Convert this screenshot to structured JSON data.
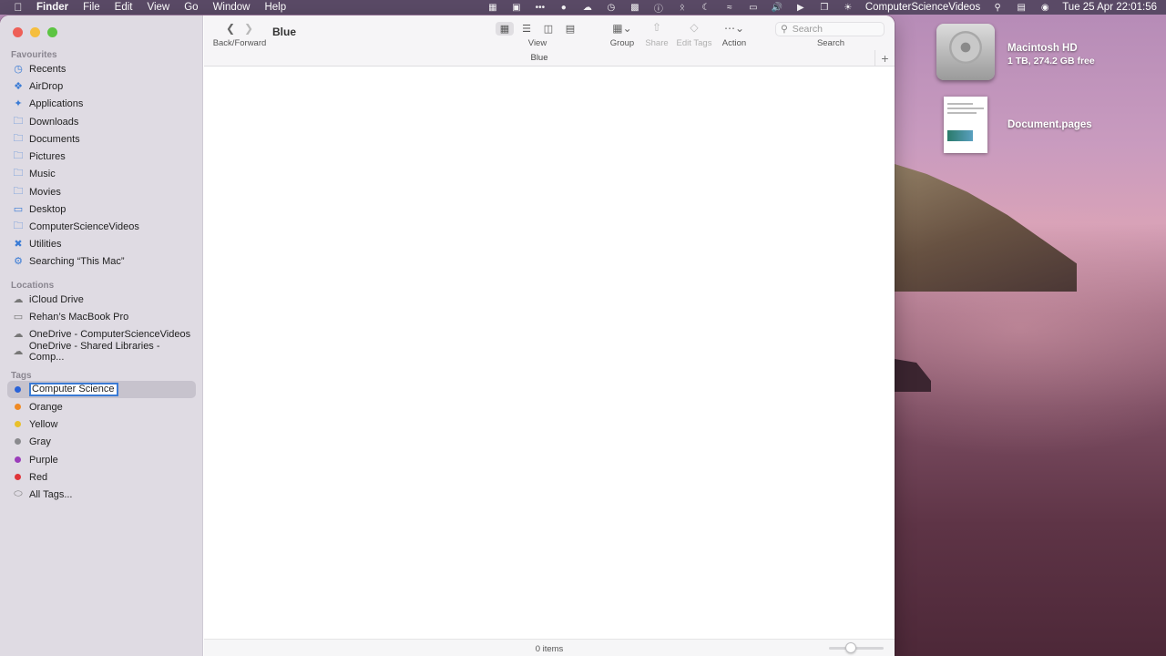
{
  "menubar": {
    "app": "Finder",
    "menus": [
      "File",
      "Edit",
      "View",
      "Go",
      "Window",
      "Help"
    ],
    "user": "ComputerScienceVideos",
    "datetime": "Tue 25 Apr  22:01:56"
  },
  "desktop": {
    "drive_name": "Macintosh HD",
    "drive_info": "1 TB, 274.2 GB free",
    "doc_name": "Document.pages"
  },
  "toolbar": {
    "back_forward_label": "Back/Forward",
    "window_title": "Blue",
    "view_label": "View",
    "group_label": "Group",
    "share_label": "Share",
    "edit_tags_label": "Edit Tags",
    "action_label": "Action",
    "search_label": "Search",
    "search_placeholder": "Search"
  },
  "path_bar": {
    "title": "Blue"
  },
  "sidebar": {
    "favourites_title": "Favourites",
    "favourites": [
      {
        "label": "Recents",
        "icon": "clock-icon"
      },
      {
        "label": "AirDrop",
        "icon": "airdrop-icon"
      },
      {
        "label": "Applications",
        "icon": "applications-icon"
      },
      {
        "label": "Downloads",
        "icon": "folder-icon"
      },
      {
        "label": "Documents",
        "icon": "folder-icon"
      },
      {
        "label": "Pictures",
        "icon": "folder-icon"
      },
      {
        "label": "Music",
        "icon": "folder-icon"
      },
      {
        "label": "Movies",
        "icon": "folder-icon"
      },
      {
        "label": "Desktop",
        "icon": "desktop-icon"
      },
      {
        "label": "ComputerScienceVideos",
        "icon": "folder-icon"
      },
      {
        "label": "Utilities",
        "icon": "utilities-icon"
      },
      {
        "label": "Searching “This Mac”",
        "icon": "gear-icon"
      }
    ],
    "locations_title": "Locations",
    "locations": [
      {
        "label": "iCloud Drive",
        "icon": "cloud-icon"
      },
      {
        "label": "Rehan’s MacBook Pro",
        "icon": "laptop-icon"
      },
      {
        "label": "OneDrive - ComputerScienceVideos",
        "icon": "cloud-icon"
      },
      {
        "label": "OneDrive - Shared Libraries - Comp...",
        "icon": "cloud-icon"
      }
    ],
    "tags_title": "Tags",
    "rename_value": "Computer Science V",
    "tags": [
      {
        "label": "Orange",
        "color": "#f08a24"
      },
      {
        "label": "Yellow",
        "color": "#e9c02a"
      },
      {
        "label": "Gray",
        "color": "#8a8a8e"
      },
      {
        "label": "Purple",
        "color": "#9b3dbb"
      },
      {
        "label": "Red",
        "color": "#e0353a"
      }
    ],
    "blue_color": "#2a63d8",
    "all_tags": "All Tags..."
  },
  "status": {
    "items_count": "0 items"
  }
}
